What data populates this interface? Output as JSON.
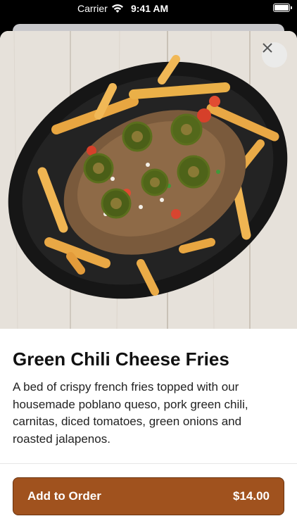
{
  "status_bar": {
    "carrier": "Carrier",
    "time": "9:41 AM",
    "icons": [
      "wifi-icon",
      "battery-icon"
    ]
  },
  "item": {
    "image_icon": "food-photo",
    "title": "Green Chili Cheese Fries",
    "description": "A bed of crispy french fries topped with our housemade poblano queso, pork green chili, carnitas, diced tomatoes, green onions and roasted jalapenos."
  },
  "close_icon": "close-icon",
  "order_button": {
    "label": "Add to Order",
    "price": "$14.00"
  },
  "colors": {
    "accent": "#a0521e",
    "accent_border": "#6a330f",
    "text": "#111111"
  }
}
